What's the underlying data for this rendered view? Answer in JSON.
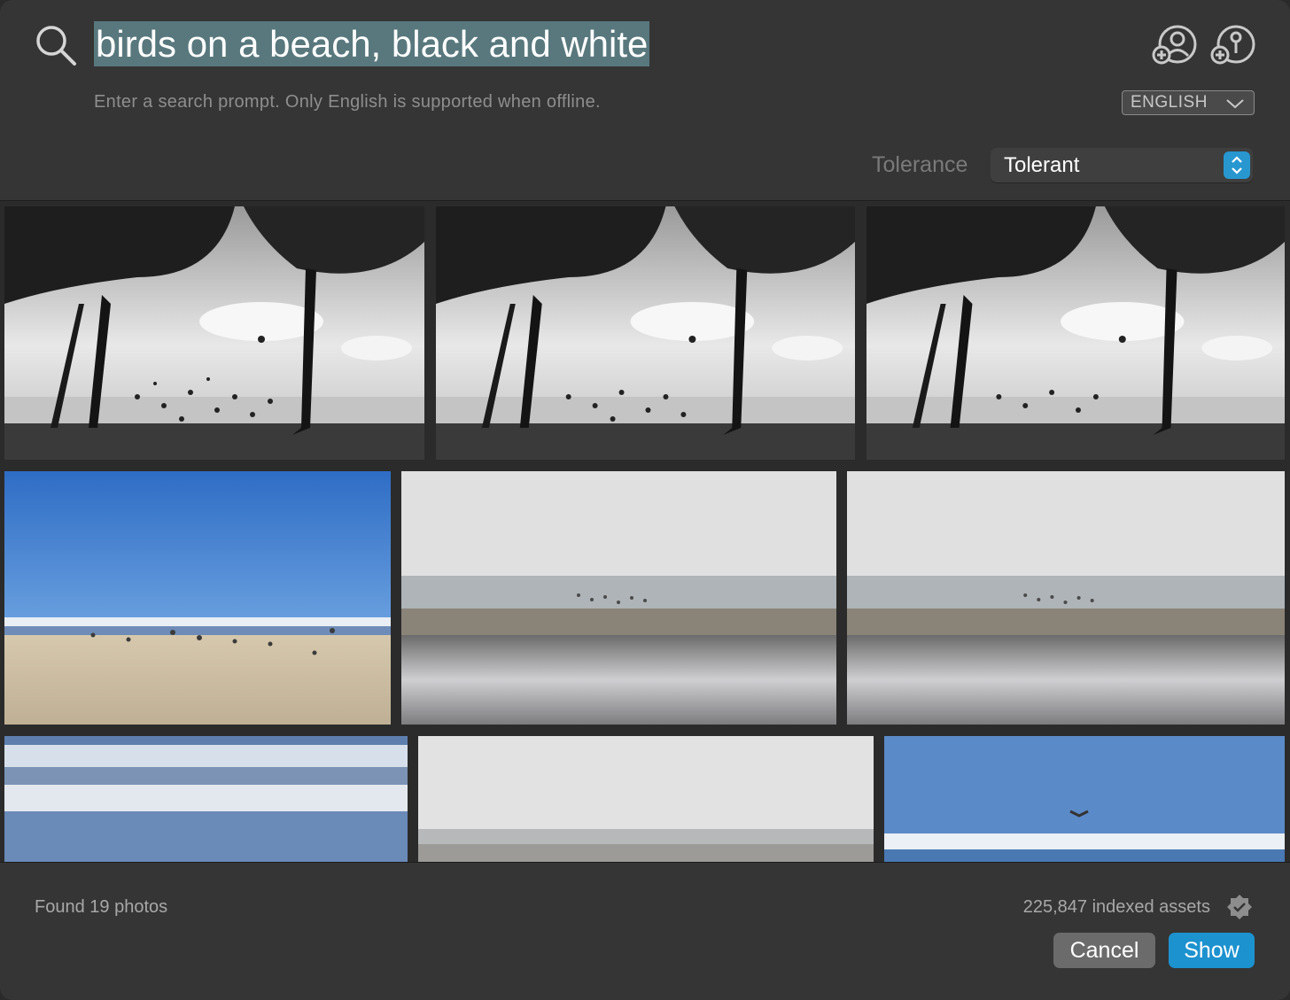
{
  "search": {
    "query": "birds on a beach, black and white",
    "hint": "Enter a search prompt. Only English is supported when offline."
  },
  "language": {
    "selected": "ENGLISH"
  },
  "tolerance": {
    "label": "Tolerance",
    "selected": "Tolerant"
  },
  "results": {
    "photos": [
      {
        "scene": "bw-trees-birds"
      },
      {
        "scene": "bw-trees-birds"
      },
      {
        "scene": "bw-trees-birds"
      },
      {
        "scene": "blue-sky-beach-gulls"
      },
      {
        "scene": "grey-beach-flock"
      },
      {
        "scene": "grey-beach-flock"
      },
      {
        "scene": "blurred-waves"
      },
      {
        "scene": "grey-sea-horizon"
      },
      {
        "scene": "blue-sky-bird-waves"
      }
    ]
  },
  "footer": {
    "found": "Found 19 photos",
    "indexed": "225,847 indexed assets",
    "cancel_label": "Cancel",
    "show_label": "Show"
  },
  "colors": {
    "accent": "#1c92cf",
    "selection": "#58787d",
    "background": "#353535"
  },
  "icons": [
    "search-icon",
    "add-person-icon",
    "add-place-icon",
    "chevron-down-icon",
    "up-down-arrows-icon",
    "verified-badge-icon"
  ]
}
